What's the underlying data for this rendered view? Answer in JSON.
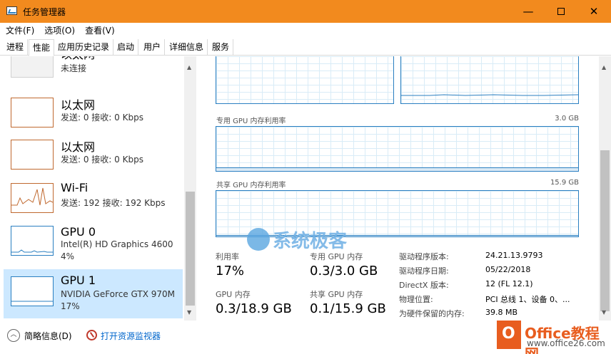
{
  "window": {
    "title": "任务管理器"
  },
  "menu": [
    "文件(F)",
    "选项(O)",
    "查看(V)"
  ],
  "tabs": [
    "进程",
    "性能",
    "应用历史记录",
    "启动",
    "用户",
    "详细信息",
    "服务"
  ],
  "active_tab": "性能",
  "devices": [
    {
      "name": "以太网",
      "line1": "未连接",
      "line2": ""
    },
    {
      "name": "以太网",
      "line1": "发送: 0 接收: 0 Kbps",
      "line2": ""
    },
    {
      "name": "以太网",
      "line1": "发送: 0 接收: 0 Kbps",
      "line2": ""
    },
    {
      "name": "Wi-Fi",
      "line1": "发送: 192 接收: 192 Kbps",
      "line2": ""
    },
    {
      "name": "GPU 0",
      "line1": "Intel(R) HD Graphics 4600",
      "line2": "4%"
    },
    {
      "name": "GPU 1",
      "line1": "NVIDIA GeForce GTX 970M",
      "line2": "17%"
    }
  ],
  "graphs": {
    "dedicated_label": "专用 GPU 内存利用率",
    "dedicated_cap": "3.0 GB",
    "shared_label": "共享 GPU 内存利用率",
    "shared_cap": "15.9 GB"
  },
  "stats": {
    "utilization_label": "利用率",
    "utilization_value": "17%",
    "dedicated_label": "专用 GPU 内存",
    "dedicated_value": "0.3/3.0 GB",
    "gpu_mem_label": "GPU 内存",
    "gpu_mem_value": "0.3/18.9 GB",
    "shared_label": "共享 GPU 内存",
    "shared_value": "0.1/15.9 GB"
  },
  "info": [
    {
      "key": "驱动程序版本:",
      "val": "24.21.13.9793"
    },
    {
      "key": "驱动程序日期:",
      "val": "05/22/2018"
    },
    {
      "key": "DirectX 版本:",
      "val": "12 (FL 12.1)"
    },
    {
      "key": "物理位置:",
      "val": "PCI 总线 1、设备 0、..."
    },
    {
      "key": "为硬件保留的内存:",
      "val": "39.8 MB"
    }
  ],
  "bottom": {
    "fewer_details": "简略信息(D)",
    "open_monitor": "打开资源监视器"
  },
  "watermarks": {
    "site1": "系统极客",
    "site2": "Office教程网",
    "site2_url": "www.office26.com"
  },
  "colors": {
    "titlebar": "#f28a1e",
    "gpu": "#2a7fc1",
    "network": "#c0692f",
    "selected": "#cce8ff"
  }
}
